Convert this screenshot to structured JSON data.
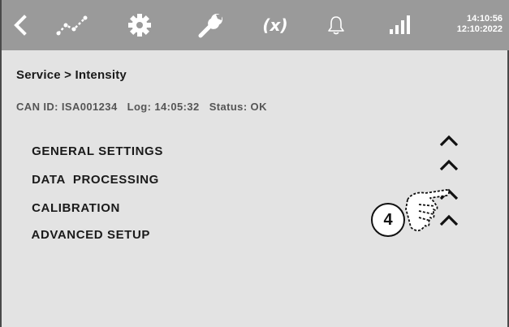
{
  "toolbar": {
    "icons": [
      "back-icon",
      "trend-icon",
      "gear-icon",
      "wrench-icon",
      "variable-icon",
      "bell-icon",
      "signal-icon"
    ],
    "variable_label": "(x)",
    "clock_time": "14:10:56",
    "clock_date": "12:10:2022"
  },
  "header": {
    "breadcrumb": "Service > Intensity",
    "can_id": "CAN ID: ISA001234",
    "log": "Log: 14:05:32",
    "status": "Status: OK"
  },
  "sections": [
    {
      "label": "GENERAL SETTINGS"
    },
    {
      "label": "DATA  PROCESSING"
    },
    {
      "label": "CALIBRATION"
    },
    {
      "label": "ADVANCED SETUP"
    }
  ],
  "overlay": {
    "step_number": "4"
  },
  "colors": {
    "topbar": "#9a9a9a",
    "background": "#e3e3e3",
    "text": "#1a1a1a",
    "icon": "#ffffff"
  }
}
